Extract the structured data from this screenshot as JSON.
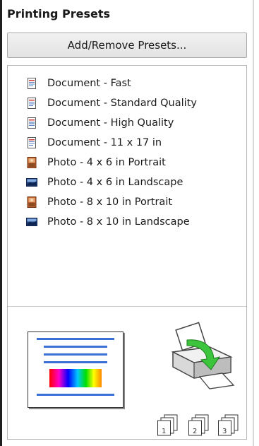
{
  "panel": {
    "title": "Printing Presets",
    "add_remove_label": "Add/Remove Presets..."
  },
  "presets": [
    {
      "label": "Document - Fast",
      "icon": "document-icon"
    },
    {
      "label": "Document - Standard Quality",
      "icon": "document-icon"
    },
    {
      "label": "Document - High Quality",
      "icon": "document-high-quality-icon"
    },
    {
      "label": "Document - 11 x 17 in",
      "icon": "document-icon"
    },
    {
      "label": "Photo - 4 x 6 in Portrait",
      "icon": "photo-portrait-icon"
    },
    {
      "label": "Photo - 4 x 6 in Landscape",
      "icon": "photo-landscape-icon"
    },
    {
      "label": "Photo - 8 x 10 in Portrait",
      "icon": "photo-portrait-icon"
    },
    {
      "label": "Photo - 8 x 10 in Landscape",
      "icon": "photo-landscape-icon"
    }
  ],
  "preview": {
    "page_icon": "document-preview-icon",
    "printer_icon": "printer-icon",
    "collate_icons": [
      {
        "icon": "collate-page-1-icon",
        "digits": "1"
      },
      {
        "icon": "collate-page-2-icon",
        "digits": "2"
      },
      {
        "icon": "collate-page-3-icon",
        "digits": "3"
      }
    ]
  }
}
